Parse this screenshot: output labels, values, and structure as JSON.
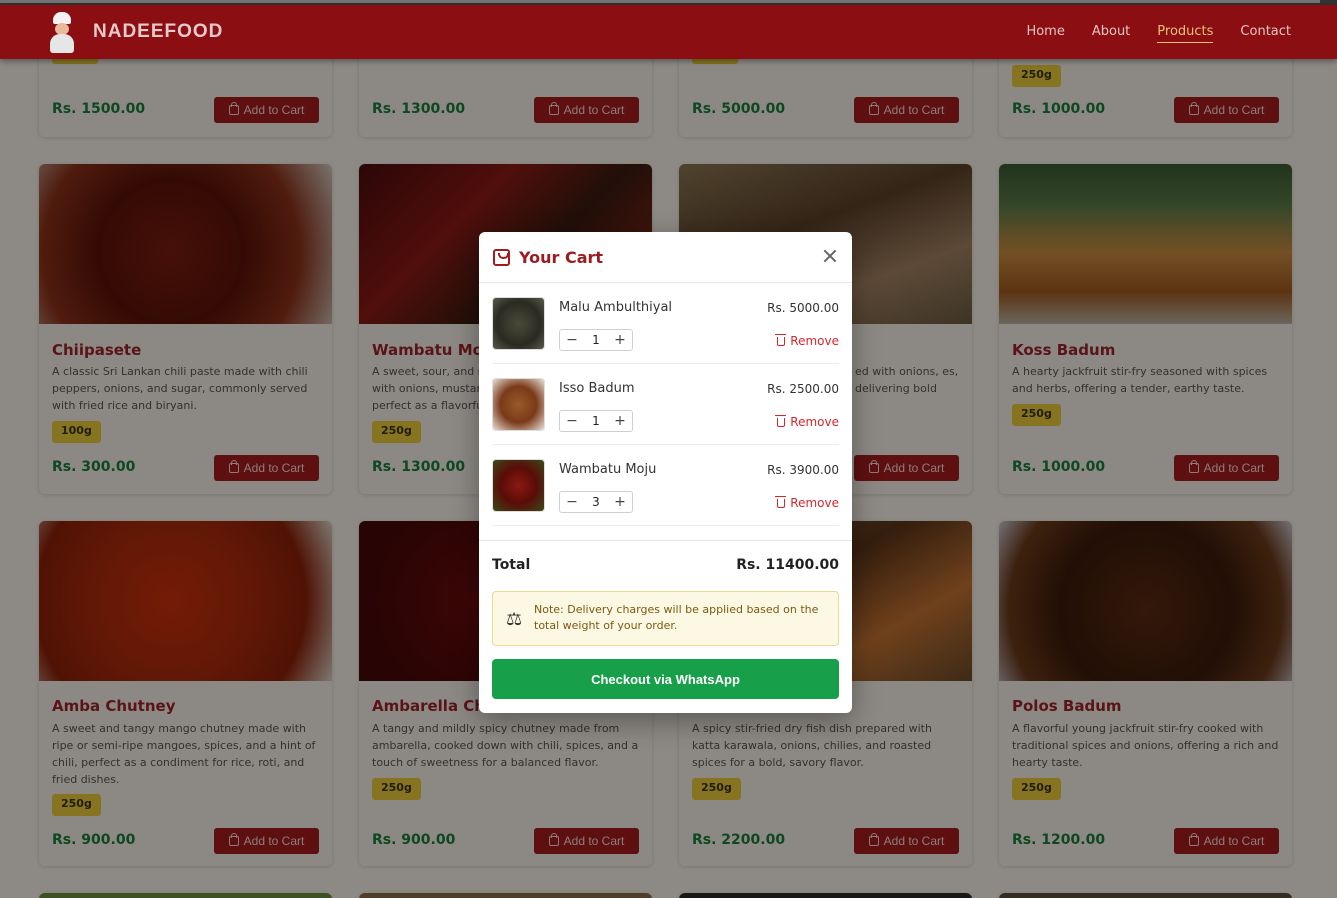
{
  "brand": {
    "name": "NADEEFOOD"
  },
  "nav": [
    "Home",
    "About",
    "Products",
    "Contact"
  ],
  "add_to_cart_label": "Add to Cart",
  "top_row": [
    {
      "price": "Rs. 1500.00"
    },
    {
      "price": "Rs. 1300.00"
    },
    {
      "price": "Rs. 5000.00"
    },
    {
      "weight": "250g",
      "price": "Rs. 1000.00"
    }
  ],
  "row2": [
    {
      "title": "Chiipasete",
      "desc": "A classic Sri Lankan chili paste made with chili peppers, onions, and sugar, commonly served with fried rice and biryani.",
      "weight": "100g",
      "price": "Rs. 300.00"
    },
    {
      "title": "Wambatu Moju",
      "desc": "A sweet, sour, and sp with onions, mustard perfect as a flavorful",
      "weight": "250g",
      "price": "Rs. 1300.00"
    },
    {
      "title": "",
      "desc": "ed with onions, es, delivering bold",
      "weight": "",
      "price": ""
    },
    {
      "title": "Koss Badum",
      "desc": "A hearty jackfruit stir-fry seasoned with spices and herbs, offering a tender, earthy taste.",
      "weight": "250g",
      "price": "Rs. 1000.00"
    }
  ],
  "row3": [
    {
      "title": "Amba Chutney",
      "desc": "A sweet and tangy mango chutney made with ripe or semi-ripe mangoes, spices, and a hint of chili, perfect as a condiment for rice, roti, and fried dishes.",
      "weight": "250g",
      "price": "Rs. 900.00"
    },
    {
      "title": "Ambarella Chut",
      "desc": "A tangy and mildly spicy chutney made from ambarella, cooked down with chili, spices, and a touch of sweetness for a balanced flavor.",
      "weight": "250g",
      "price": "Rs. 900.00"
    },
    {
      "title": "",
      "desc": "A spicy stir-fried dry fish dish prepared with katta karawala, onions, chilies, and roasted spices for a bold, savory flavor.",
      "weight": "250g",
      "price": "Rs. 2200.00"
    },
    {
      "title": "Polos Badum",
      "desc": "A flavorful young jackfruit stir-fry cooked with traditional spices and onions, offering a rich and hearty taste.",
      "weight": "250g",
      "price": "Rs. 1200.00"
    }
  ],
  "cart": {
    "title": "Your Cart",
    "items": [
      {
        "name": "Malu Ambulthiyal",
        "price": "Rs. 5000.00",
        "qty": "1",
        "remove": "Remove"
      },
      {
        "name": "Isso Badum",
        "price": "Rs. 2500.00",
        "qty": "1",
        "remove": "Remove"
      },
      {
        "name": "Wambatu Moju",
        "price": "Rs. 3900.00",
        "qty": "3",
        "remove": "Remove"
      }
    ],
    "total_label": "Total",
    "total_value": "Rs. 11400.00",
    "note": "Note: Delivery charges will be applied based on the total weight of your order.",
    "checkout_label": "Checkout via WhatsApp"
  },
  "colors": {
    "brand_red": "#8b0e12",
    "price_green": "#1a7a3a",
    "checkout_green": "#17a049",
    "remove_red": "#d6272b",
    "weight_badge": "#e8c93a"
  },
  "icons": [
    "chef-logo-icon",
    "shopping-bag-icon",
    "close-icon",
    "trash-icon",
    "minus-icon",
    "plus-icon",
    "scale-icon"
  ]
}
